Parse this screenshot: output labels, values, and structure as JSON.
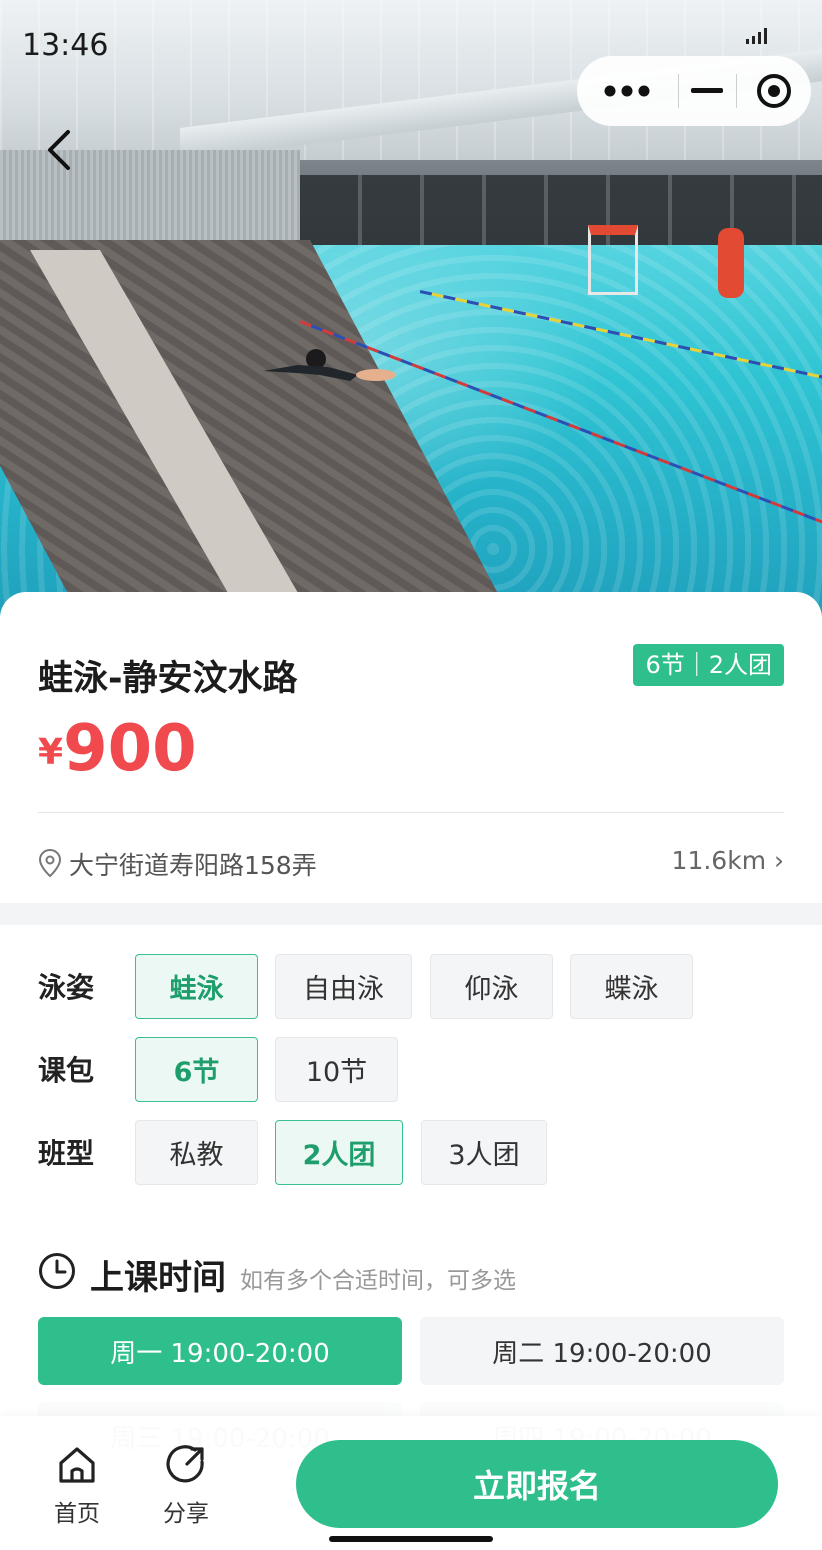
{
  "status_bar": {
    "time": "13:46"
  },
  "product": {
    "title": "蛙泳-静安汶水路",
    "tag": "6节｜2人团",
    "price_currency": "¥",
    "price_value": "900",
    "address": "大宁街道寿阳路158弄",
    "distance": "11.6km ›"
  },
  "options": {
    "stroke": {
      "label": "泳姿",
      "choices": [
        "蛙泳",
        "自由泳",
        "仰泳",
        "蝶泳"
      ],
      "selected": "蛙泳"
    },
    "package": {
      "label": "课包",
      "choices": [
        "6节",
        "10节"
      ],
      "selected": "6节"
    },
    "class_type": {
      "label": "班型",
      "choices": [
        "私教",
        "2人团",
        "3人团"
      ],
      "selected": "2人团"
    }
  },
  "schedule": {
    "title": "上课时间",
    "hint": "如有多个合适时间，可多选",
    "slots": [
      {
        "label": "周一 19:00-20:00",
        "selected": true
      },
      {
        "label": "周二 19:00-20:00",
        "selected": false
      },
      {
        "label": "周三 19:00-20:00",
        "selected": false
      },
      {
        "label": "周四 19:00-20:00",
        "selected": false
      }
    ]
  },
  "bottom_bar": {
    "home_label": "首页",
    "share_label": "分享",
    "cta_label": "立即报名"
  },
  "colors": {
    "accent": "#2fbf8c",
    "price": "#f04a4f",
    "selected_bg": "#ecf8f3"
  }
}
